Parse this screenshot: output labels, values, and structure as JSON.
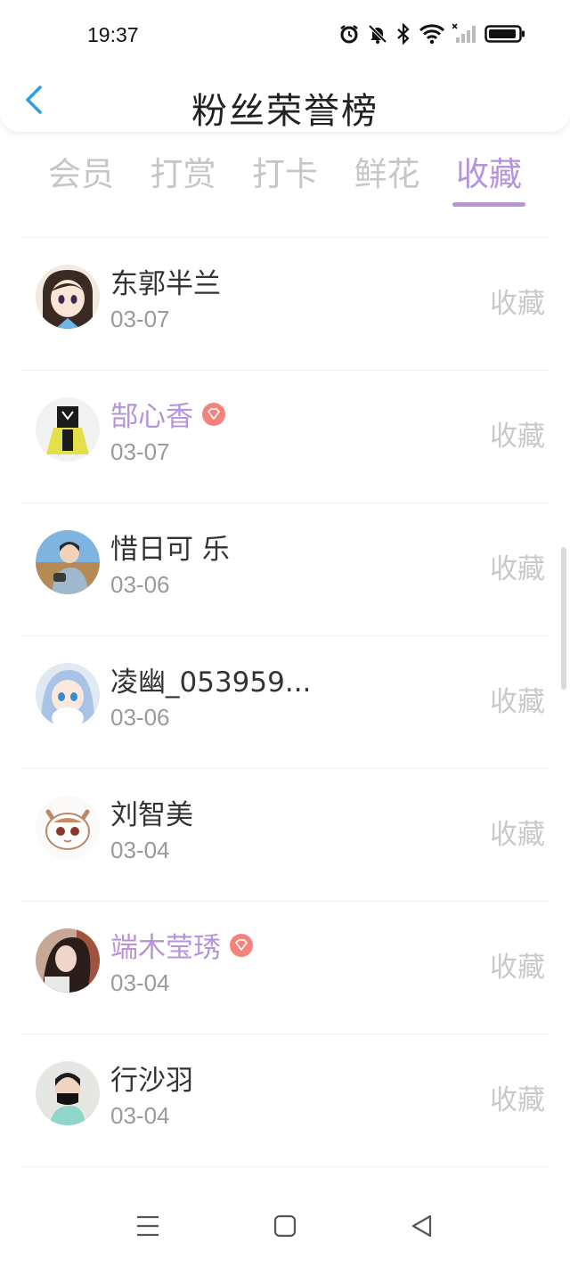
{
  "status_bar": {
    "time": "19:37"
  },
  "header": {
    "title": "粉丝荣誉榜"
  },
  "tabs": [
    {
      "label": "会员",
      "active": false
    },
    {
      "label": "打赏",
      "active": false
    },
    {
      "label": "打卡",
      "active": false
    },
    {
      "label": "鲜花",
      "active": false
    },
    {
      "label": "收藏",
      "active": true
    }
  ],
  "fans": [
    {
      "name": "东郭半兰",
      "date": "03-07",
      "action": "收藏",
      "vip": false
    },
    {
      "name": "郜心香",
      "date": "03-07",
      "action": "收藏",
      "vip": true
    },
    {
      "name": "惜日可 乐",
      "date": "03-06",
      "action": "收藏",
      "vip": false
    },
    {
      "name": "凌幽_053959...",
      "date": "03-06",
      "action": "收藏",
      "vip": false
    },
    {
      "name": "刘智美",
      "date": "03-04",
      "action": "收藏",
      "vip": false
    },
    {
      "name": "端木莹琇",
      "date": "03-04",
      "action": "收藏",
      "vip": true
    },
    {
      "name": "行沙羽",
      "date": "03-04",
      "action": "收藏",
      "vip": false
    }
  ],
  "colors": {
    "accent": "#b793d9",
    "vip_badge": "#f4837d",
    "back_arrow": "#2f9ee8"
  },
  "icons": [
    "alarm-icon",
    "mute-icon",
    "bluetooth-icon",
    "wifi-icon",
    "signal-icon",
    "battery-icon",
    "back-arrow-icon",
    "menu-nav-icon",
    "home-nav-icon",
    "back-nav-icon"
  ]
}
